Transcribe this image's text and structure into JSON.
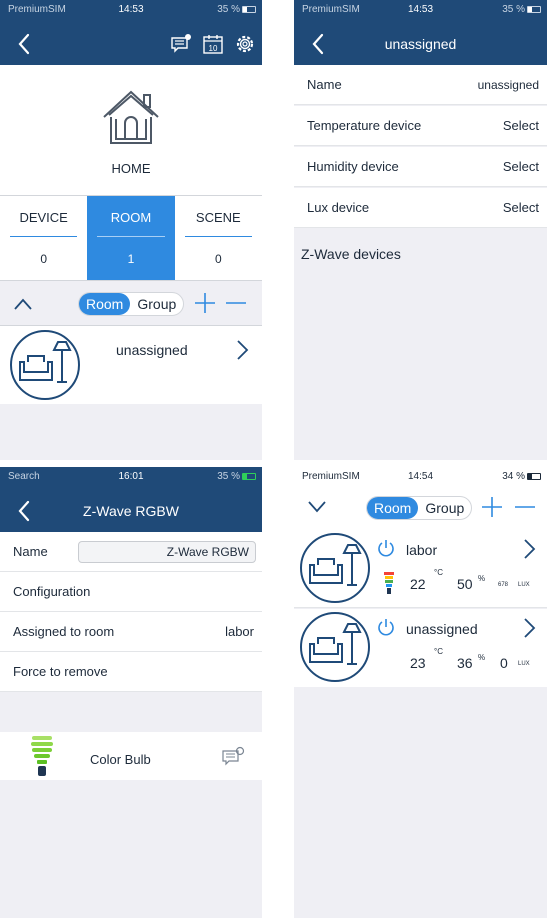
{
  "panel1": {
    "status": {
      "carrier": "PremiumSIM",
      "time": "14:53",
      "battery": "35 %",
      "battery_level": 0.35
    },
    "home_label": "HOME",
    "tabs": [
      {
        "label": "DEVICE",
        "count": "0"
      },
      {
        "label": "ROOM",
        "count": "1"
      },
      {
        "label": "SCENE",
        "count": "0"
      }
    ],
    "segment": {
      "room": "Room",
      "group": "Group"
    },
    "rooms": [
      {
        "name": "unassigned"
      }
    ]
  },
  "panel2": {
    "status": {
      "carrier": "PremiumSIM",
      "time": "14:53",
      "battery": "35 %",
      "battery_level": 0.35
    },
    "title": "unassigned",
    "rows": [
      {
        "label": "Name",
        "value": "unassigned"
      },
      {
        "label": "Temperature device",
        "value": "Select"
      },
      {
        "label": "Humidity device",
        "value": "Select"
      },
      {
        "label": "Lux device",
        "value": "Select"
      }
    ],
    "section": "Z-Wave devices"
  },
  "panel3": {
    "status": {
      "carrier": "Search",
      "time": "16:01",
      "battery": "35 %",
      "battery_level": 0.35
    },
    "title": "Z-Wave RGBW",
    "name_label": "Name",
    "name_value": "Z-Wave RGBW",
    "rows": [
      {
        "label": "Configuration",
        "value": ""
      },
      {
        "label": "Assigned to room",
        "value": "labor"
      },
      {
        "label": "Force to remove",
        "value": ""
      }
    ],
    "device": {
      "name": "Color Bulb"
    }
  },
  "panel4": {
    "status": {
      "carrier": "PremiumSIM",
      "time": "14:54",
      "battery": "34 %",
      "battery_level": 0.34
    },
    "segment": {
      "room": "Room",
      "group": "Group"
    },
    "rooms": [
      {
        "name": "labor",
        "temp": "22",
        "temp_unit": "°C",
        "humidity": "50",
        "humidity_unit": "%",
        "lux": "678",
        "lux_unit": "LUX"
      },
      {
        "name": "unassigned",
        "temp": "23",
        "temp_unit": "°C",
        "humidity": "36",
        "humidity_unit": "%",
        "lux": "0",
        "lux_unit": "LUX"
      }
    ]
  },
  "colors": {
    "navbar": "#1f4a78",
    "accent": "#2f8ae0",
    "background": "#efeff4"
  }
}
